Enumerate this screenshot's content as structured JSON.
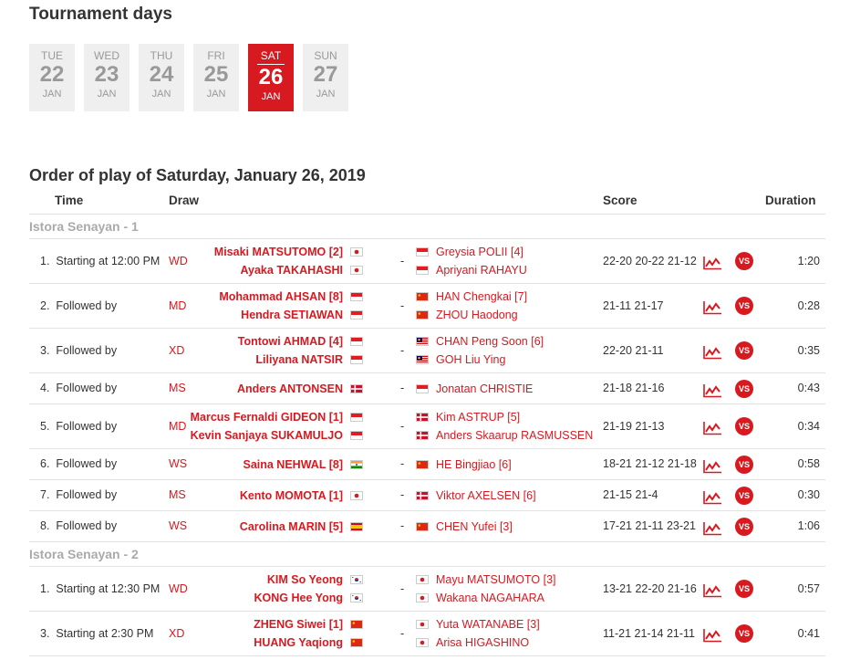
{
  "tournament_days": {
    "title": "Tournament days",
    "days": [
      {
        "dow": "TUE",
        "num": "22",
        "mon": "JAN",
        "active": false
      },
      {
        "dow": "WED",
        "num": "23",
        "mon": "JAN",
        "active": false
      },
      {
        "dow": "THU",
        "num": "24",
        "mon": "JAN",
        "active": false
      },
      {
        "dow": "FRI",
        "num": "25",
        "mon": "JAN",
        "active": false
      },
      {
        "dow": "SAT",
        "num": "26",
        "mon": "JAN",
        "active": true
      },
      {
        "dow": "SUN",
        "num": "27",
        "mon": "JAN",
        "active": false
      }
    ]
  },
  "order": {
    "title": "Order of play of Saturday, January 26, 2019",
    "headers": {
      "time": "Time",
      "draw": "Draw",
      "score": "Score",
      "duration": "Duration"
    },
    "stats_icon": "stats-chart-icon",
    "vs_label": "VS",
    "colors": {
      "accent": "#d71920",
      "muted": "#aaaaaa"
    },
    "courts": [
      {
        "name": "Istora Senayan - 1",
        "matches": [
          {
            "num": "1.",
            "time": "Starting at 12:00 PM",
            "draw": "WD",
            "home": [
              {
                "name": "Misaki MATSUTOMO [2]",
                "flag": "JPN"
              },
              {
                "name": "Ayaka TAKAHASHI",
                "flag": "JPN"
              }
            ],
            "away": [
              {
                "name": "Greysia POLII [4]",
                "flag": "INA"
              },
              {
                "name": "Apriyani RAHAYU",
                "flag": "INA"
              }
            ],
            "score": "22-20 20-22 21-12",
            "duration": "1:20"
          },
          {
            "num": "2.",
            "time": "Followed by",
            "draw": "MD",
            "home": [
              {
                "name": "Mohammad AHSAN [8]",
                "flag": "INA"
              },
              {
                "name": "Hendra SETIAWAN",
                "flag": "INA"
              }
            ],
            "away": [
              {
                "name": "HAN Chengkai [7]",
                "flag": "CHN"
              },
              {
                "name": "ZHOU Haodong",
                "flag": "CHN"
              }
            ],
            "score": "21-11 21-17",
            "duration": "0:28"
          },
          {
            "num": "3.",
            "time": "Followed by",
            "draw": "XD",
            "home": [
              {
                "name": "Tontowi AHMAD [4]",
                "flag": "INA"
              },
              {
                "name": "Liliyana NATSIR",
                "flag": "INA"
              }
            ],
            "away": [
              {
                "name": "CHAN Peng Soon [6]",
                "flag": "MAS"
              },
              {
                "name": "GOH Liu Ying",
                "flag": "MAS"
              }
            ],
            "score": "22-20 21-11",
            "duration": "0:35"
          },
          {
            "num": "4.",
            "time": "Followed by",
            "draw": "MS",
            "home": [
              {
                "name": "Anders ANTONSEN",
                "flag": "DEN"
              }
            ],
            "away": [
              {
                "name": "Jonatan CHRISTIE",
                "flag": "INA"
              }
            ],
            "score": "21-18 21-16",
            "duration": "0:43"
          },
          {
            "num": "5.",
            "time": "Followed by",
            "draw": "MD",
            "home": [
              {
                "name": "Marcus Fernaldi GIDEON [1]",
                "flag": "INA"
              },
              {
                "name": "Kevin Sanjaya SUKAMULJO",
                "flag": "INA"
              }
            ],
            "away": [
              {
                "name": "Kim ASTRUP [5]",
                "flag": "DEN"
              },
              {
                "name": "Anders Skaarup RASMUSSEN",
                "flag": "DEN"
              }
            ],
            "score": "21-19 21-13",
            "duration": "0:34"
          },
          {
            "num": "6.",
            "time": "Followed by",
            "draw": "WS",
            "home": [
              {
                "name": "Saina NEHWAL [8]",
                "flag": "IND"
              }
            ],
            "away": [
              {
                "name": "HE Bingjiao [6]",
                "flag": "CHN"
              }
            ],
            "score": "18-21 21-12 21-18",
            "duration": "0:58"
          },
          {
            "num": "7.",
            "time": "Followed by",
            "draw": "MS",
            "home": [
              {
                "name": "Kento MOMOTA [1]",
                "flag": "JPN"
              }
            ],
            "away": [
              {
                "name": "Viktor AXELSEN [6]",
                "flag": "DEN"
              }
            ],
            "score": "21-15 21-4",
            "duration": "0:30"
          },
          {
            "num": "8.",
            "time": "Followed by",
            "draw": "WS",
            "home": [
              {
                "name": "Carolina MARIN [5]",
                "flag": "ESP"
              }
            ],
            "away": [
              {
                "name": "CHEN Yufei [3]",
                "flag": "CHN"
              }
            ],
            "score": "17-21 21-11 23-21",
            "duration": "1:06"
          }
        ]
      },
      {
        "name": "Istora Senayan - 2",
        "matches": [
          {
            "num": "1.",
            "time": "Starting at 12:30 PM",
            "draw": "WD",
            "home": [
              {
                "name": "KIM So Yeong",
                "flag": "KOR"
              },
              {
                "name": "KONG Hee Yong",
                "flag": "KOR"
              }
            ],
            "away": [
              {
                "name": "Mayu MATSUMOTO [3]",
                "flag": "JPN"
              },
              {
                "name": "Wakana NAGAHARA",
                "flag": "JPN"
              }
            ],
            "score": "13-21 22-20 21-16",
            "duration": "0:57"
          },
          {
            "num": "3.",
            "time": "Starting at 2:30 PM",
            "draw": "XD",
            "home": [
              {
                "name": "ZHENG Siwei [1]",
                "flag": "CHN"
              },
              {
                "name": "HUANG Yaqiong",
                "flag": "CHN"
              }
            ],
            "away": [
              {
                "name": "Yuta WATANABE [3]",
                "flag": "JPN"
              },
              {
                "name": "Arisa HIGASHINO",
                "flag": "JPN"
              }
            ],
            "score": "11-21 21-14 21-11",
            "duration": "0:41"
          }
        ]
      }
    ]
  }
}
